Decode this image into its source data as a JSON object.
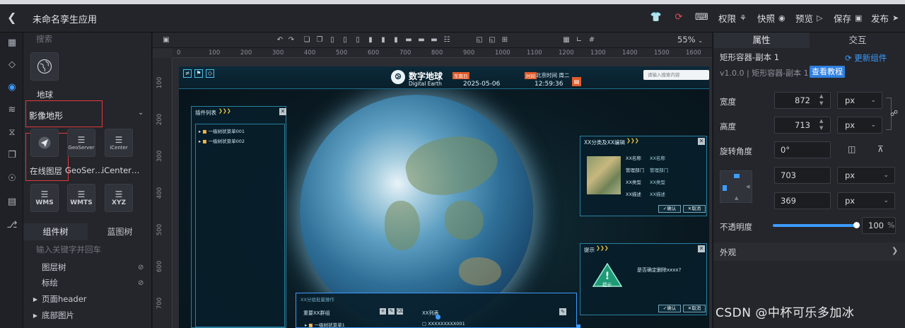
{
  "app": {
    "title": "未命名孪生应用"
  },
  "topbar": {
    "buttons": [
      {
        "label": "权限",
        "icon": "share-icon"
      },
      {
        "label": "快照",
        "icon": "camera-icon"
      },
      {
        "label": "预览",
        "icon": "play-icon"
      },
      {
        "label": "保存",
        "icon": "save-icon"
      },
      {
        "label": "发布",
        "icon": "send-icon"
      }
    ]
  },
  "library": {
    "search_placeholder": "搜索",
    "top_item": "地球",
    "section": "影像地形",
    "items": [
      "在线图层",
      "GeoSer…",
      "iCenter…"
    ],
    "item_badges": [
      "GeoServer",
      "iCenter"
    ],
    "tiles": [
      "WMS",
      "WMTS",
      "XYZ"
    ],
    "tabs": [
      "组件树",
      "蓝图树"
    ],
    "tree_search_placeholder": "输入关键字并回车",
    "tree": [
      {
        "label": "图层树",
        "expandable": false
      },
      {
        "label": "标绘",
        "expandable": false
      },
      {
        "label": "页面header",
        "expandable": true
      },
      {
        "label": "底部图片",
        "expandable": true
      }
    ]
  },
  "canvas": {
    "zoom": "55%",
    "ruler_h": [
      "0",
      "100",
      "200",
      "300",
      "400",
      "500",
      "600",
      "700",
      "800",
      "900",
      "1000",
      "1100",
      "1200",
      "1300",
      "1400",
      "1500",
      "1600"
    ],
    "ruler_v": [
      "100",
      "200",
      "300",
      "400",
      "500",
      "600",
      "700"
    ]
  },
  "preview": {
    "brand_title": "数字地球",
    "brand_subtitle": "Digital Earth",
    "date_tag": "东南日",
    "date": "2025-05-06",
    "time_label": "北京时间 周二",
    "time_tag": "时间",
    "time": "12:59:36",
    "search_placeholder": "请输入搜索内容",
    "plugin_panel": {
      "title": "插件列表",
      "items": [
        "一级树状菜单001",
        "一级树状菜单002"
      ]
    },
    "detail_panel": {
      "title": "XX分类及XX编辑",
      "fields": [
        {
          "k": "XX名称",
          "v": "XX名称"
        },
        {
          "k": "管理部门",
          "v": "管理部门"
        },
        {
          "k": "XX类型",
          "v": "XX类型"
        },
        {
          "k": "XX描述",
          "v": "XX描述"
        }
      ],
      "ok": "确认",
      "cancel": "取消"
    },
    "tip_panel": {
      "title": "提示",
      "badge": "提示",
      "message": "是否确定删除xxxx?",
      "ok": "确认",
      "cancel": "取消"
    },
    "bottom_panel": {
      "title": "XX分组批量操作",
      "left_title": "重要XX群组",
      "left_item": "一级树状菜单1",
      "right_title": "XX列表",
      "right_item": "XXXXXXXXX001"
    }
  },
  "props": {
    "tabs": [
      "属性",
      "交互"
    ],
    "component_name": "矩形容器-副本 1",
    "update_link": "更新组件",
    "version": "v1.0.0 | 矩形容器-副本 1",
    "tutorial": "查看教程",
    "width_label": "宽度",
    "width": "872",
    "width_unit": "px",
    "height_label": "高度",
    "height": "713",
    "height_unit": "px",
    "rotate_label": "旋转角度",
    "rotate": "0°",
    "x": "703",
    "x_unit": "px",
    "y": "369",
    "y_unit": "px",
    "opacity_label": "不透明度",
    "opacity": "100",
    "opacity_unit": "%",
    "opacity_fraction": 1.0,
    "appearance": "外观"
  },
  "watermark": "CSDN @中杯可乐多加冰",
  "colors": {
    "accent": "#3d9cff",
    "highlight": "#e03a3a",
    "bg": "#1b1d22"
  }
}
